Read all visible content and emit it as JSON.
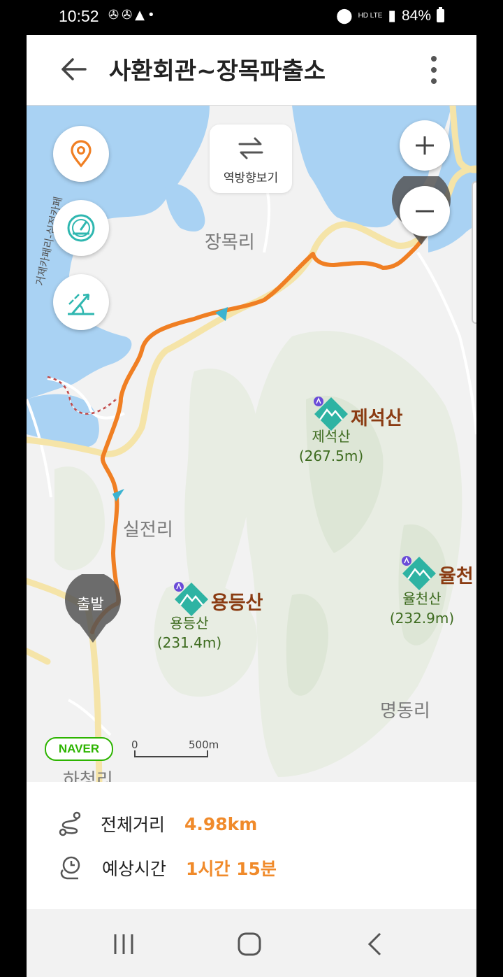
{
  "status_bar": {
    "time": "10:52",
    "network": "HD LTE",
    "battery": "84%"
  },
  "header": {
    "title": "사환회관~장목파출소"
  },
  "map_controls": {
    "reverse_label": "역방향보기"
  },
  "places": {
    "jangmok": "장목리",
    "siljeon": "실전리",
    "myeongdong": "명동리",
    "hacheon": "하청리"
  },
  "road_label": "거제카페리-심전카페",
  "peaks": [
    {
      "name": "제석산",
      "sub_name": "제석산",
      "elevation": "(267.5m)"
    },
    {
      "name": "용등산",
      "sub_name": "용등산",
      "elevation": "(231.4m)"
    },
    {
      "name": "율천",
      "sub_name": "율천산",
      "elevation": "(232.9m)"
    }
  ],
  "start_marker": "출발",
  "map_footer": {
    "brand": "NAVER",
    "scale_zero": "0",
    "scale_distance": "500m"
  },
  "summary": {
    "distance_label": "전체거리",
    "distance_value": "4.98km",
    "time_label": "예상시간",
    "time_value": "1시간 15분"
  },
  "colors": {
    "route": "#f07f23",
    "water": "#a9d2f3",
    "accent": "#f08a2a",
    "peak_icon": "#2eb3a3"
  },
  "icons": [
    "location-pin-icon",
    "speedometer-icon",
    "slope-icon",
    "swap-arrows-icon",
    "zoom-in-icon",
    "zoom-out-icon"
  ]
}
